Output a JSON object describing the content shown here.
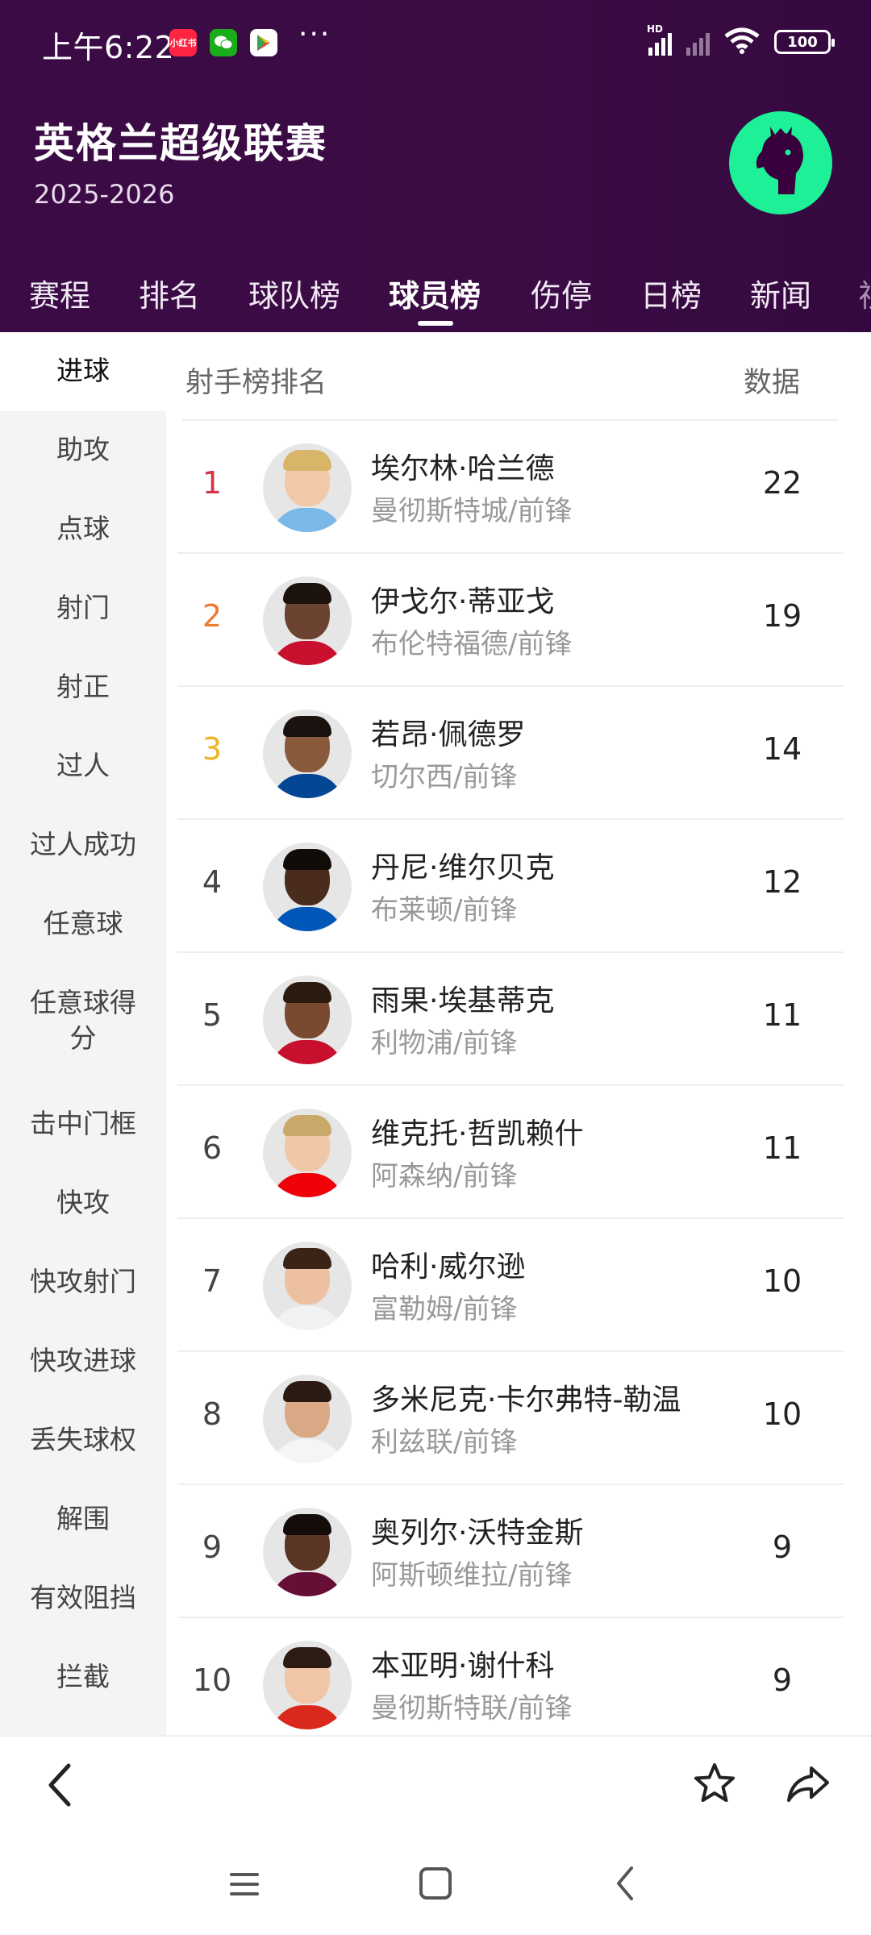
{
  "status_bar": {
    "time": "上午6:22",
    "app_badge": "小红书",
    "dots": "···",
    "battery": "100",
    "signal_label": "HD"
  },
  "header": {
    "title": "英格兰超级联赛",
    "season": "2025-2026"
  },
  "tabs": [
    {
      "label": "赛程"
    },
    {
      "label": "排名"
    },
    {
      "label": "球队榜"
    },
    {
      "label": "球员榜",
      "active": true
    },
    {
      "label": "伤停"
    },
    {
      "label": "日榜"
    },
    {
      "label": "新闻"
    },
    {
      "label": "视"
    }
  ],
  "sidebar": {
    "items": [
      {
        "label": "进球",
        "active": true
      },
      {
        "label": "助攻"
      },
      {
        "label": "点球"
      },
      {
        "label": "射门"
      },
      {
        "label": "射正"
      },
      {
        "label": "过人"
      },
      {
        "label": "过人成功"
      },
      {
        "label": "任意球"
      },
      {
        "label": "任意球得分"
      },
      {
        "label": "击中门框"
      },
      {
        "label": "快攻"
      },
      {
        "label": "快攻射门"
      },
      {
        "label": "快攻进球"
      },
      {
        "label": "丢失球权"
      },
      {
        "label": "解围"
      },
      {
        "label": "有效阻挡"
      },
      {
        "label": "拦截"
      }
    ]
  },
  "list": {
    "title": "射手榜排名",
    "value_header": "数据",
    "rows": [
      {
        "rank": "1",
        "name": "埃尔林·哈兰德",
        "team": "曼彻斯特城/前锋",
        "value": "22"
      },
      {
        "rank": "2",
        "name": "伊戈尔·蒂亚戈",
        "team": "布伦特福德/前锋",
        "value": "19"
      },
      {
        "rank": "3",
        "name": "若昂·佩德罗",
        "team": "切尔西/前锋",
        "value": "14"
      },
      {
        "rank": "4",
        "name": "丹尼·维尔贝克",
        "team": "布莱顿/前锋",
        "value": "12"
      },
      {
        "rank": "5",
        "name": "雨果·埃基蒂克",
        "team": "利物浦/前锋",
        "value": "11"
      },
      {
        "rank": "6",
        "name": "维克托·哲凯赖什",
        "team": "阿森纳/前锋",
        "value": "11"
      },
      {
        "rank": "7",
        "name": "哈利·威尔逊",
        "team": "富勒姆/前锋",
        "value": "10"
      },
      {
        "rank": "8",
        "name": "多米尼克·卡尔弗特-勒温",
        "team": "利兹联/前锋",
        "value": "10"
      },
      {
        "rank": "9",
        "name": "奥列尔·沃特金斯",
        "team": "阿斯顿维拉/前锋",
        "value": "9"
      },
      {
        "rank": "10",
        "name": "本亚明·谢什科",
        "team": "曼彻斯特联/前锋",
        "value": "9"
      }
    ]
  },
  "bottom_bar": {
    "icons": [
      "back-arrow-icon",
      "star-icon",
      "share-icon"
    ]
  },
  "nav_bar": {
    "icons": [
      "menu-icon",
      "home-square-icon",
      "back-chevron-icon"
    ]
  },
  "colors": {
    "header_bg": "#3a0b44",
    "logo_green": "#1df096",
    "rank1": "#d53446",
    "rank2": "#ef7a2f",
    "rank3": "#f0b323"
  }
}
